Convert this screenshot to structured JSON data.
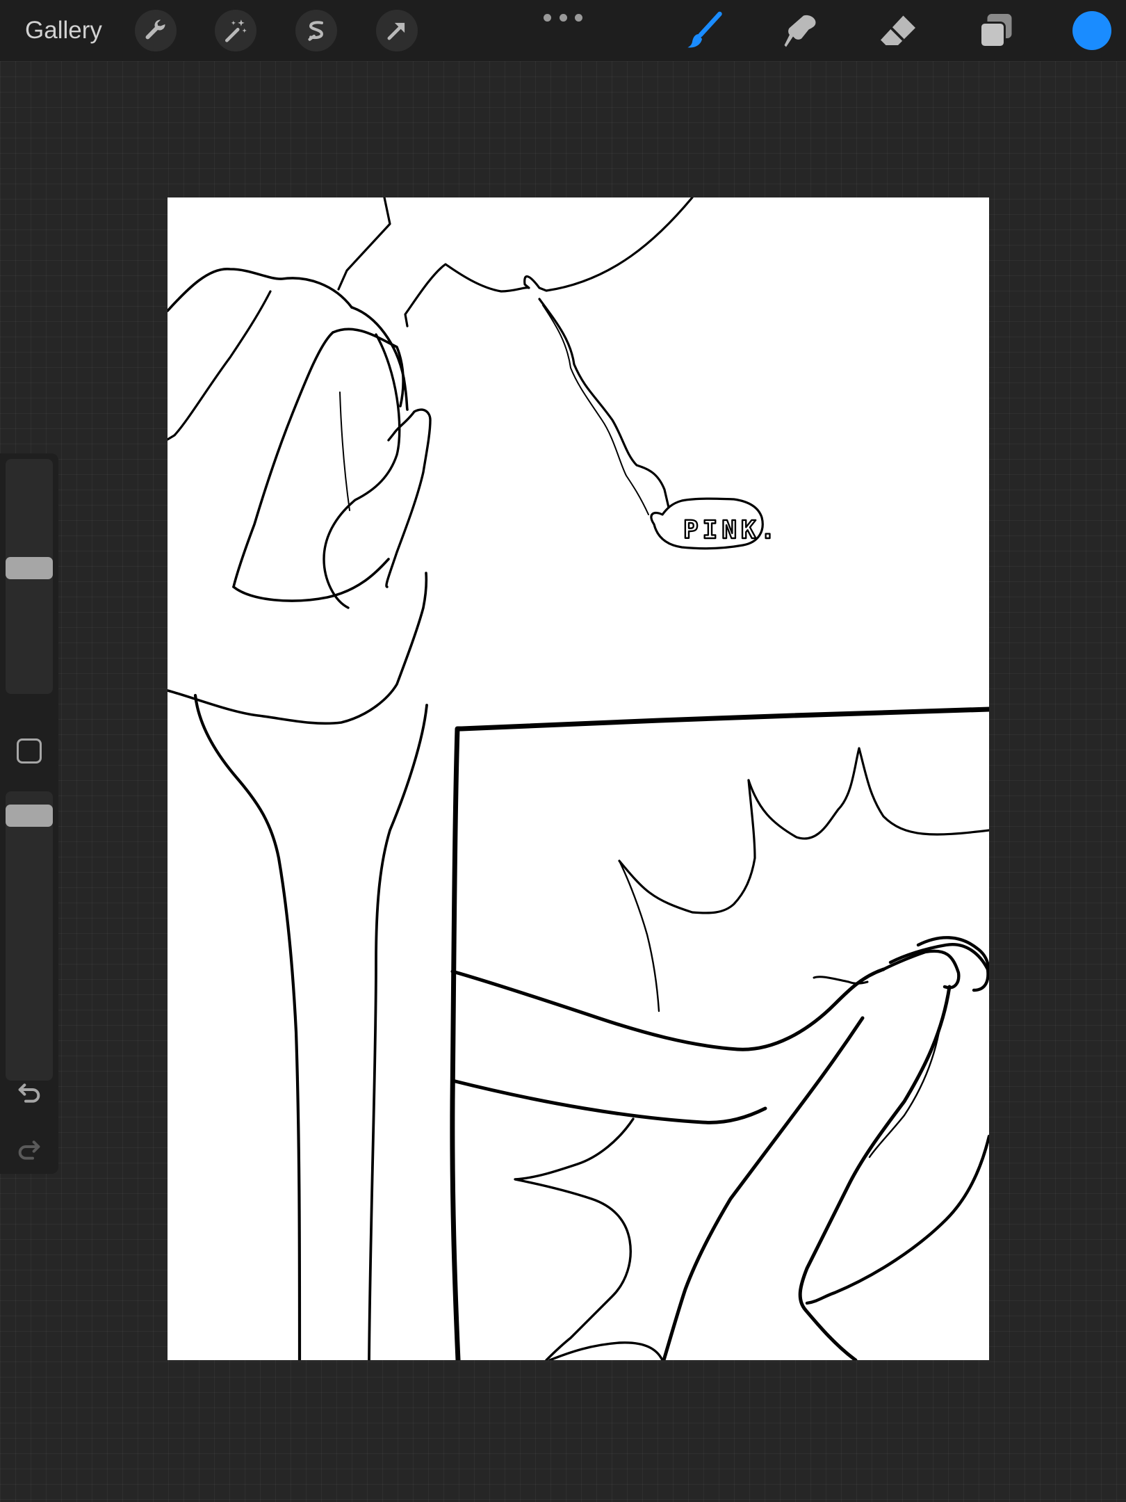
{
  "topbar": {
    "gallery_label": "Gallery",
    "left_tools": [
      "wrench-icon",
      "magic-wand-icon",
      "selection-icon",
      "transform-arrow-icon"
    ],
    "right_tools": [
      "brush-icon",
      "smudge-icon",
      "eraser-icon",
      "layers-icon"
    ],
    "active_tool": "brush",
    "accent_color": "#1a8cff",
    "current_color": "#1a8cff"
  },
  "sidebar": {
    "brush_size": 0.54,
    "brush_opacity": 0.95,
    "icons": [
      "modify-square-icon",
      "undo-icon",
      "redo-icon"
    ]
  },
  "canvas": {
    "speech_bubble_text": "PINK."
  }
}
